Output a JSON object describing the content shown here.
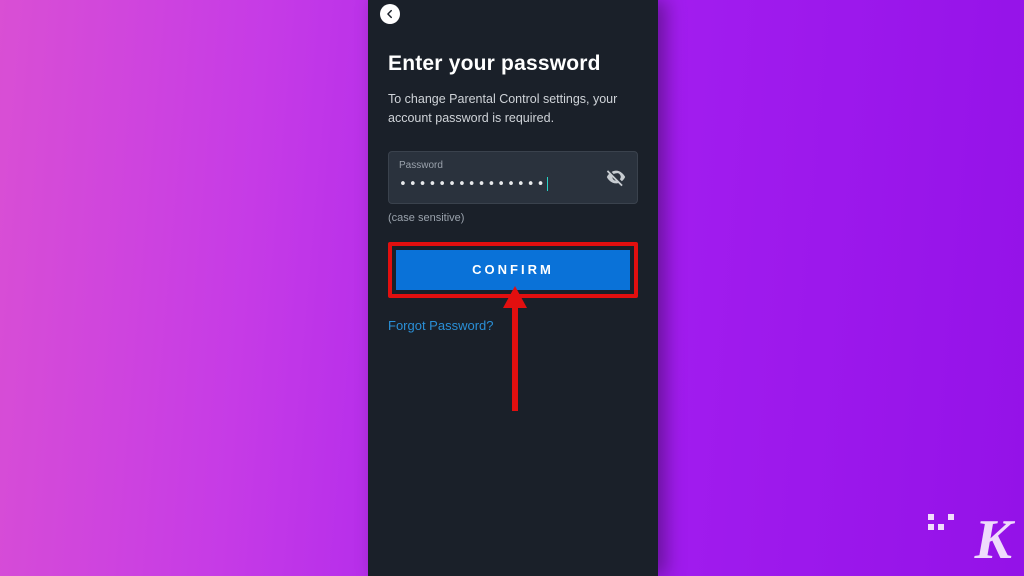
{
  "title": "Enter your password",
  "description": "To change Parental Control settings, your account password is required.",
  "password": {
    "label": "Password",
    "masked_value": "•••••••••••••••",
    "hint": "(case sensitive)"
  },
  "confirm_label": "CONFIRM",
  "forgot_label": "Forgot Password?",
  "watermark": "K",
  "colors": {
    "accent": "#0a72d8",
    "highlight": "#e20f0f",
    "link": "#2a8fd6"
  }
}
